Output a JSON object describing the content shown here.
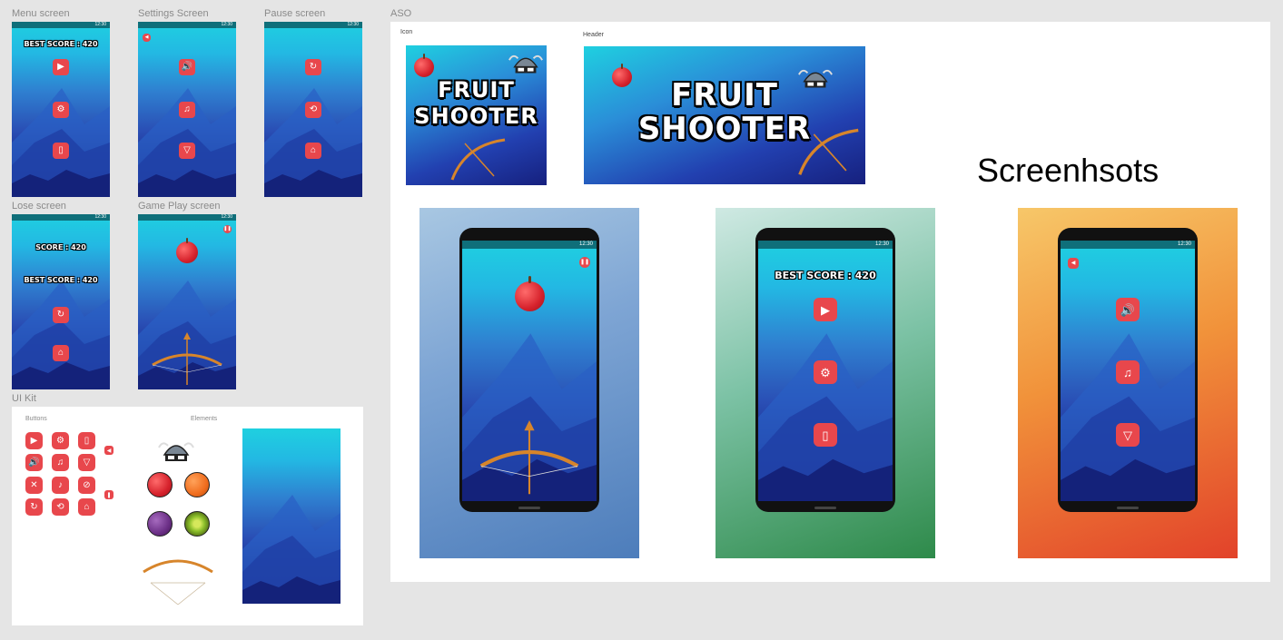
{
  "frames": {
    "menu": "Menu screen",
    "settings": "Settings Screen",
    "pause": "Pause screen",
    "lose": "Lose screen",
    "gameplay": "Game Play screen",
    "uikit": "UI Kit",
    "aso": "ASO"
  },
  "status_time": "12:30",
  "best_score": "BEST SCORE : 420",
  "score": "SCORE : 420",
  "uikit": {
    "buttons_label": "Buttons",
    "elements_label": "Elements"
  },
  "aso": {
    "icon_label": "Icon",
    "header_label": "Header",
    "game_title_line1": "FRUIT",
    "game_title_line2": "SHOOTER",
    "screenshots_title": "Screenhsots"
  },
  "colors": {
    "accent": "#e8474c",
    "sky_top": "#1fd0e0",
    "sky_bottom": "#101a66",
    "canvas_bg": "#e5e5e5"
  },
  "icons": {
    "play": "play-icon",
    "settings": "gear-icon",
    "exit": "exit-door-icon",
    "sound": "speaker-icon",
    "music": "music-note-icon",
    "trash": "trash-icon",
    "replay": "replay-icon",
    "restart": "restart-icon",
    "home": "home-icon",
    "pause": "pause-icon",
    "back": "back-icon"
  }
}
